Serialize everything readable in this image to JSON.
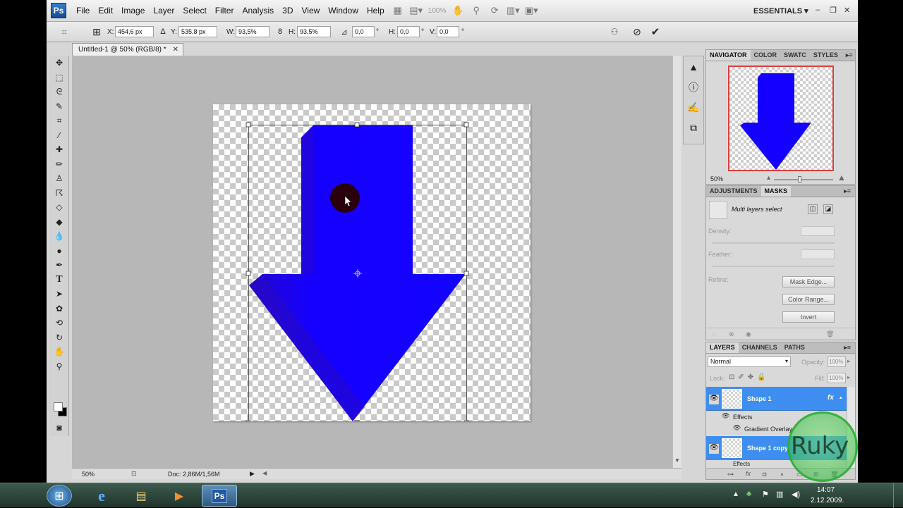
{
  "menubar": {
    "app_icon": "Ps",
    "items": [
      "File",
      "Edit",
      "Image",
      "Layer",
      "Select",
      "Filter",
      "Analysis",
      "3D",
      "View",
      "Window",
      "Help"
    ],
    "zoom_field": "100%",
    "workspace": "ESSENTIALS"
  },
  "options": {
    "x_label": "X:",
    "x_value": "454,6 px",
    "y_label": "Y:",
    "y_value": "535,8 px",
    "w_label": "W:",
    "w_value": "93,5%",
    "h_label": "H:",
    "h_value": "93,5%",
    "angle_value": "0,0",
    "hskew_label": "H:",
    "hskew_value": "0,0",
    "vskew_label": "V:",
    "vskew_value": "0,0",
    "degree_symbol": "°"
  },
  "document": {
    "tab_title": "Untitled-1 @ 50% (RGB/8) *",
    "close_glyph": "✕",
    "zoom": "50%",
    "doc_info": "Doc: 2,86M/1,56M",
    "shape_color": "#1400ff"
  },
  "navigator": {
    "tabs": [
      "NAVIGATOR",
      "COLOR",
      "SWATC",
      "STYLES"
    ],
    "zoom": "50%"
  },
  "masks": {
    "tabs": [
      "ADJUSTMENTS",
      "MASKS"
    ],
    "status": "Multi layers select",
    "density_label": "Density:",
    "feather_label": "Feather:",
    "refine_label": "Refine:",
    "buttons": [
      "Mask Edge...",
      "Color Range...",
      "Invert"
    ]
  },
  "layers": {
    "tabs": [
      "LAYERS",
      "CHANNELS",
      "PATHS"
    ],
    "blend_mode": "Normal",
    "opacity_label": "Opacity:",
    "opacity_value": "100%",
    "lock_label": "Lock:",
    "fill_label": "Fill:",
    "fill_value": "100%",
    "items": [
      {
        "name": "Shape 1",
        "effects_label": "Effects",
        "effect": "Gradient Overlay"
      },
      {
        "name": "Shape 1 copy",
        "effects_label": "Effects"
      }
    ],
    "fx": "fx"
  },
  "watermark": "Ruky",
  "taskbar": {
    "active_app": "Ps",
    "time": "14:07",
    "date": "2.12.2009."
  }
}
